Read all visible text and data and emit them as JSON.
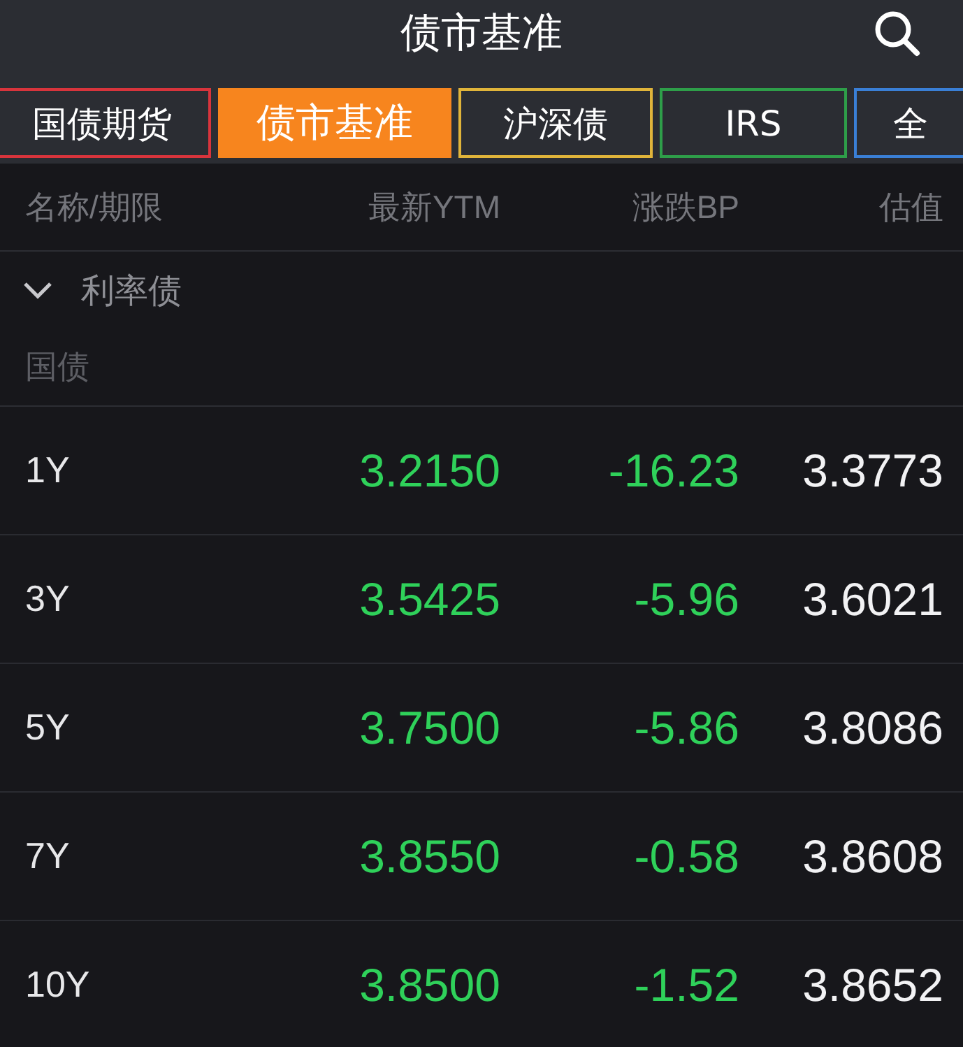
{
  "header": {
    "title": "债市基准"
  },
  "tabs": [
    {
      "label": "国债期货",
      "selected": false,
      "color": "#d8343c"
    },
    {
      "label": "债市基准",
      "selected": true,
      "color": "#f7851e"
    },
    {
      "label": "沪深债",
      "selected": false,
      "color": "#e0b43a"
    },
    {
      "label": "IRS",
      "selected": false,
      "color": "#2e9e49"
    },
    {
      "label": "全",
      "selected": false,
      "color": "#3a7fd6"
    }
  ],
  "table": {
    "columns": [
      "名称/期限",
      "最新YTM",
      "涨跌BP",
      "估值"
    ],
    "section": {
      "label": "利率债",
      "expanded": true
    },
    "group": "国债",
    "rows": [
      {
        "term": "1Y",
        "ytm": "3.2150",
        "change": "-16.23",
        "valuation": "3.3773",
        "color": "#2fd15a"
      },
      {
        "term": "3Y",
        "ytm": "3.5425",
        "change": "-5.96",
        "valuation": "3.6021",
        "color": "#2fd15a"
      },
      {
        "term": "5Y",
        "ytm": "3.7500",
        "change": "-5.86",
        "valuation": "3.8086",
        "color": "#2fd15a"
      },
      {
        "term": "7Y",
        "ytm": "3.8550",
        "change": "-0.58",
        "valuation": "3.8608",
        "color": "#2fd15a"
      },
      {
        "term": "10Y",
        "ytm": "3.8500",
        "change": "-1.52",
        "valuation": "3.8652",
        "color": "#2fd15a"
      }
    ]
  }
}
